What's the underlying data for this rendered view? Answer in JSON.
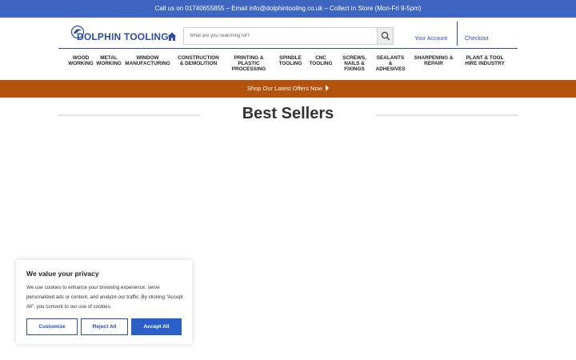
{
  "topbar": {
    "text": "Call us on 01740655855 – Email info@dolphintooling.co.uk – Collect in Store (Mon-Fri 9-5pm)"
  },
  "header": {
    "logo_text": "DOLPHIN TOOLING",
    "search_placeholder": "What are you searching for?",
    "account_label": "Your Account",
    "checkout_label": "Checkout"
  },
  "nav": {
    "items": [
      {
        "label": "WOOD\nWORKING"
      },
      {
        "label": "METAL\nWORKING"
      },
      {
        "label": "WINDOW\nMANUFACTURING"
      },
      {
        "label": "CONSTRUCTION\n& DEMOLITION"
      },
      {
        "label": "PRINTING &\nPLASTIC\nPROCESSING"
      },
      {
        "label": "SPINDLE\nTOOLING"
      },
      {
        "label": "CNC\nTOOLING"
      },
      {
        "label": "SCREWS,\nNAILS &\nFIXINGS"
      },
      {
        "label": "SEALANTS\n&\nADHESIVES"
      },
      {
        "label": "SHARPENING &\nREPAIR"
      },
      {
        "label": "PLANT & TOOL\nHIRE INDUSTRY"
      }
    ]
  },
  "offers_bar": {
    "label": "Shop Our Latest Offers Now"
  },
  "section": {
    "title": "Best Sellers"
  },
  "cookie": {
    "title": "We value your privacy",
    "text": "We use cookies to enhance your browsing experience, serve personalized ads or content, and analyze our traffic. By clicking \"Accept All\", you consent to our use of cookies.",
    "customize_label": "Customize",
    "reject_label": "Reject All",
    "accept_label": "Accept All"
  },
  "colors": {
    "topbar": "#3e66c0",
    "brand_blue": "#2a4ea5",
    "offers_bar": "#b4520c",
    "accept_button": "#2a5fc9"
  }
}
